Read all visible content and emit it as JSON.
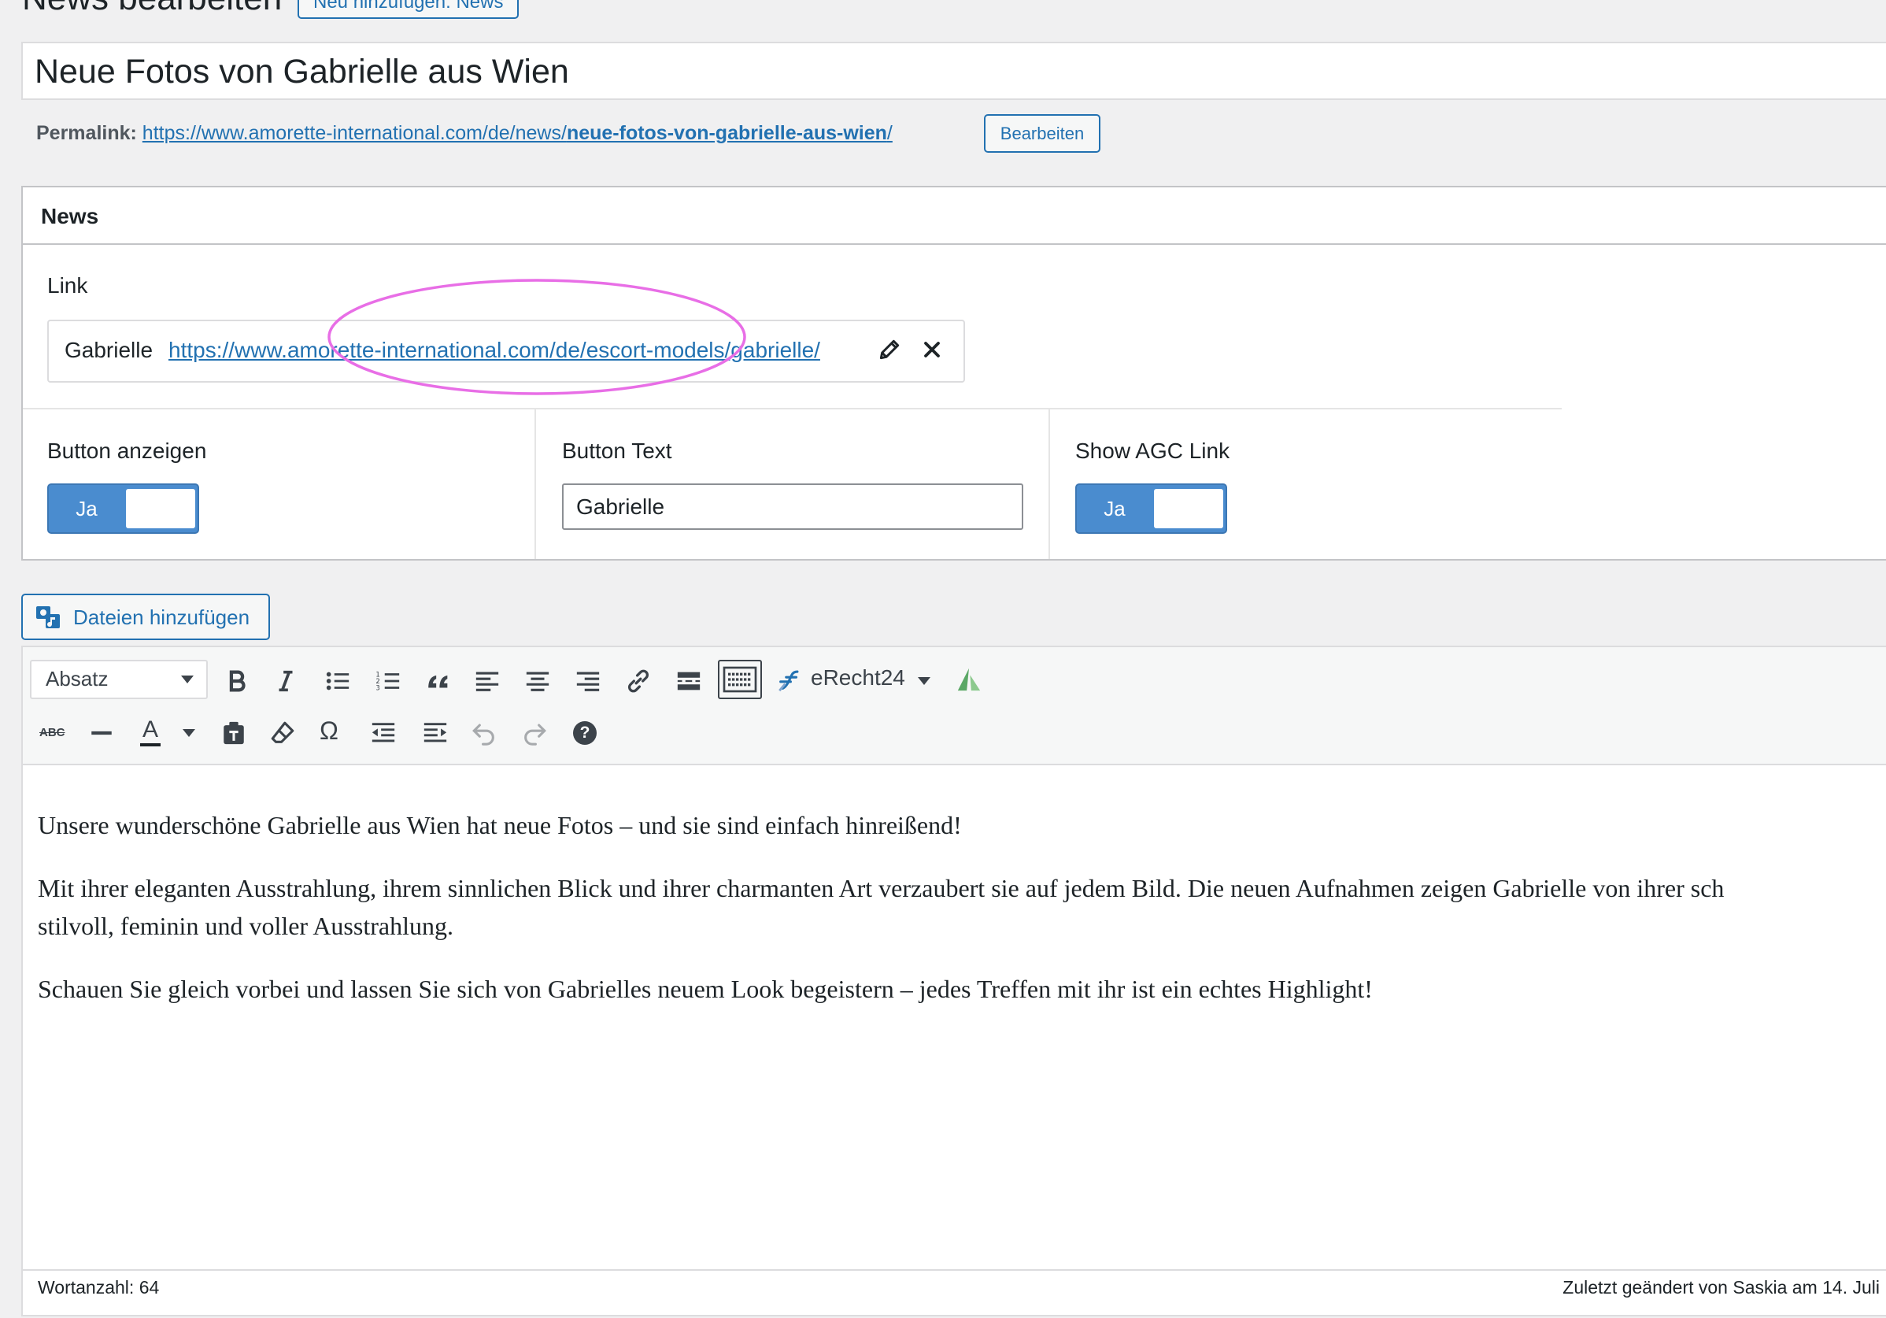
{
  "header": {
    "page_title": "News bearbeiten",
    "add_new_label": "Neu hinzufügen: News"
  },
  "post": {
    "title": "Neue Fotos von Gabrielle aus Wien",
    "permalink_label": "Permalink:",
    "permalink_base": "https://www.amorette-international.com/de/news/",
    "permalink_slug": "neue-fotos-von-gabrielle-aus-wien",
    "permalink_trailing": "/",
    "permalink_edit_label": "Bearbeiten"
  },
  "news_box": {
    "title": "News",
    "link_label": "Link",
    "link_name": "Gabrielle",
    "link_url": "https://www.amorette-international.com/de/escort-models/gabrielle/",
    "button_show_label": "Button anzeigen",
    "button_show_value": "Ja",
    "button_text_label": "Button Text",
    "button_text_value": "Gabrielle",
    "agc_label": "Show AGC Link",
    "agc_value": "Ja",
    "highlight_color": "#e86ee6",
    "toggle_color": "#4a8ccf"
  },
  "media": {
    "add_files_label": "Dateien hinzufügen"
  },
  "editor": {
    "format_select": "Absatz",
    "erecht_label": "eRecht24",
    "toolbar_row1_icons": [
      "bold-icon",
      "italic-icon",
      "bullet-list-icon",
      "numbered-list-icon",
      "blockquote-icon",
      "align-left-icon",
      "align-center-icon",
      "align-right-icon",
      "link-icon",
      "read-more-icon",
      "toolbar-toggle-icon",
      "erecht-icon",
      "chevron-down-icon",
      "plugin-logo-icon"
    ],
    "toolbar_row2_icons": [
      "strikethrough-icon",
      "horizontal-line-icon",
      "text-color-icon",
      "paste-text-icon",
      "clear-formatting-icon",
      "special-character-icon",
      "outdent-icon",
      "indent-icon",
      "undo-icon",
      "redo-icon",
      "help-icon"
    ],
    "strikethrough_text": "ABC",
    "text_color_letter": "A",
    "special_char": "Ω",
    "help_char": "?",
    "paragraphs": [
      "Unsere wunderschöne Gabrielle aus Wien hat neue Fotos – und sie sind einfach hinreißend!",
      "Mit ihrer eleganten Ausstrahlung, ihrem sinnlichen Blick und ihrer charmanten Art verzaubert sie auf jedem Bild. Die neuen Aufnahmen zeigen Gabrielle von ihrer sch",
      "stilvoll, feminin und voller Ausstrahlung.",
      "Schauen Sie gleich vorbei und lassen Sie sich von Gabrielles neuem Look begeistern – jedes Treffen mit ihr ist ein echtes Highlight!"
    ],
    "word_count": "Wortanzahl: 64",
    "last_edited": "Zuletzt geändert von Saskia am 14. Juli"
  }
}
